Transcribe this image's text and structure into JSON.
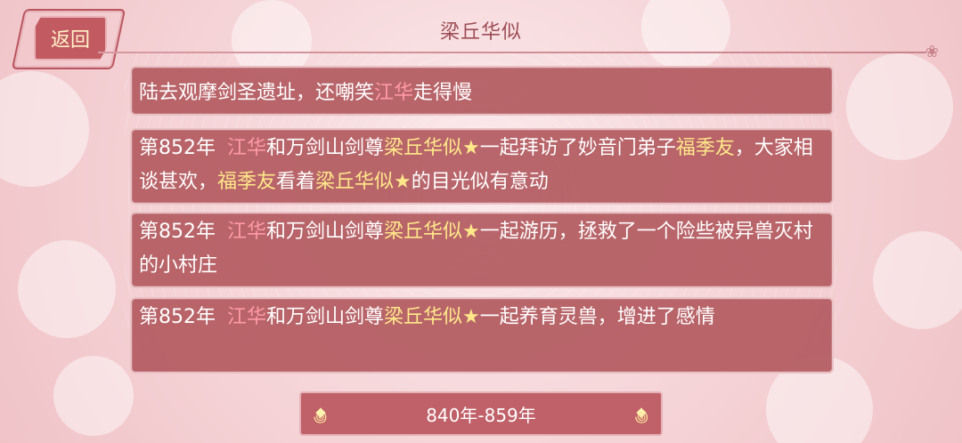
{
  "header": {
    "title": "梁丘华似",
    "back_label": "返回"
  },
  "events": {
    "partial": [
      {
        "text": "陆去观摩剑圣遗址，还嘲笑",
        "class": ""
      },
      {
        "text": "江华",
        "class": "name-red"
      },
      {
        "text": "走得慢",
        "class": ""
      }
    ],
    "items": [
      [
        {
          "text": "第852年 ",
          "class": "year"
        },
        {
          "text": "江华",
          "class": "name-red"
        },
        {
          "text": "和万剑山剑尊",
          "class": ""
        },
        {
          "text": "梁丘华似★",
          "class": "name-gold"
        },
        {
          "text": "一起拜访了妙音门弟子",
          "class": ""
        },
        {
          "text": "福季友",
          "class": "name-gold"
        },
        {
          "text": "，大家相谈甚欢，",
          "class": ""
        },
        {
          "text": "福季友",
          "class": "name-gold"
        },
        {
          "text": "看着",
          "class": ""
        },
        {
          "text": "梁丘华似★",
          "class": "name-gold"
        },
        {
          "text": "的目光似有意动",
          "class": ""
        }
      ],
      [
        {
          "text": "第852年 ",
          "class": "year"
        },
        {
          "text": "江华",
          "class": "name-red"
        },
        {
          "text": "和万剑山剑尊",
          "class": ""
        },
        {
          "text": "梁丘华似★",
          "class": "name-gold"
        },
        {
          "text": "一起游历，拯救了一个险些被异兽灭村的小村庄",
          "class": ""
        }
      ],
      [
        {
          "text": "第852年 ",
          "class": "year"
        },
        {
          "text": "江华",
          "class": "name-red"
        },
        {
          "text": "和万剑山剑尊",
          "class": ""
        },
        {
          "text": "梁丘华似★",
          "class": "name-gold"
        },
        {
          "text": "一起养育灵兽，增进了感情",
          "class": ""
        }
      ]
    ]
  },
  "period": {
    "label": "840年-859年"
  },
  "colors": {
    "card_bg": "#b25a60",
    "name_red": "#ff9aa6",
    "name_gold": "#ffe88a",
    "title": "#9d4d55"
  }
}
